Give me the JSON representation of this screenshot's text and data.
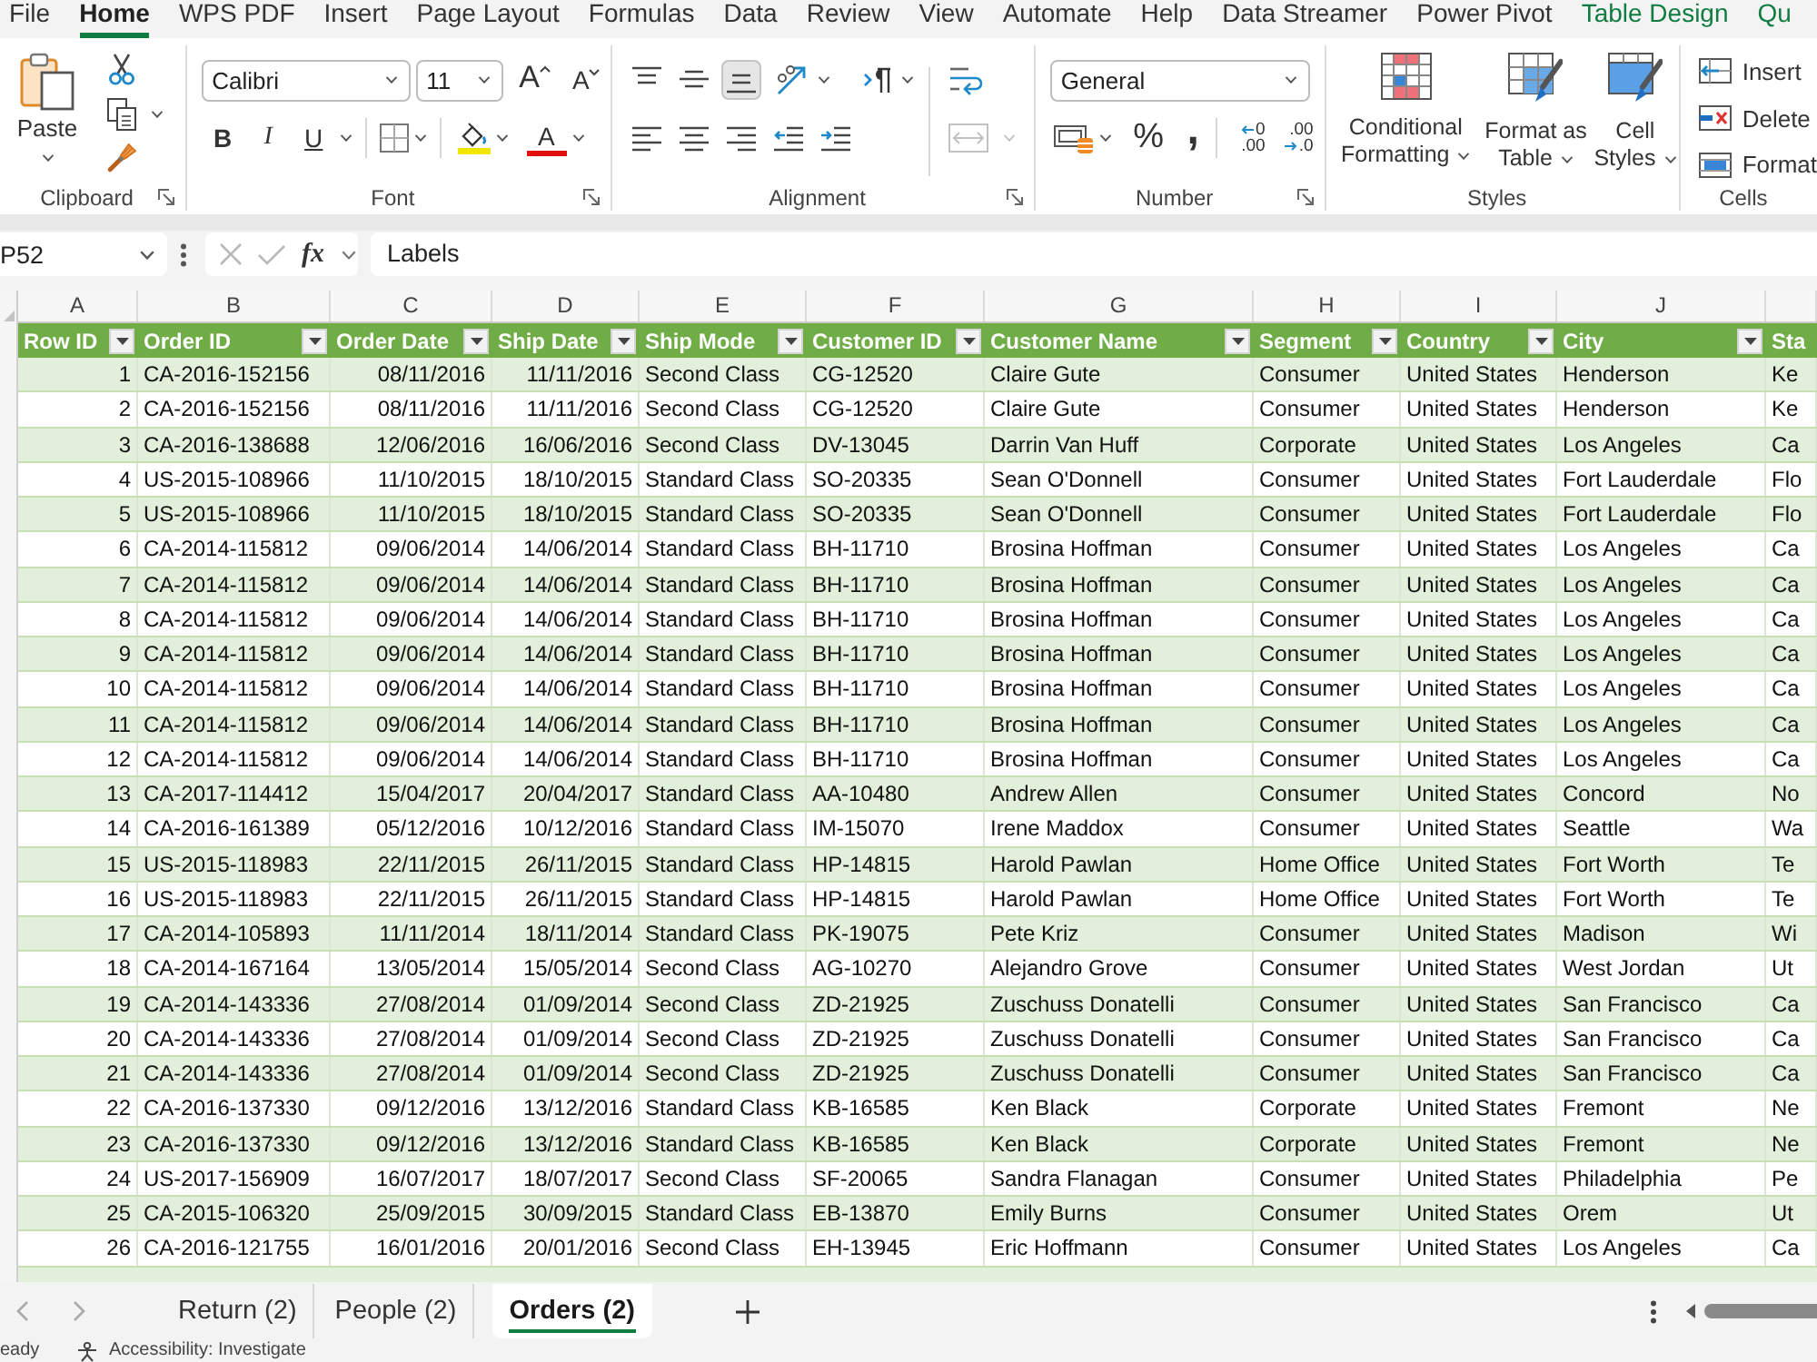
{
  "menu_tabs": [
    {
      "label": "File",
      "selected": false,
      "kind": "standard"
    },
    {
      "label": "Home",
      "selected": true,
      "kind": "standard"
    },
    {
      "label": "WPS PDF",
      "selected": false,
      "kind": "standard"
    },
    {
      "label": "Insert",
      "selected": false,
      "kind": "standard"
    },
    {
      "label": "Page Layout",
      "selected": false,
      "kind": "standard"
    },
    {
      "label": "Formulas",
      "selected": false,
      "kind": "standard"
    },
    {
      "label": "Data",
      "selected": false,
      "kind": "standard"
    },
    {
      "label": "Review",
      "selected": false,
      "kind": "standard"
    },
    {
      "label": "View",
      "selected": false,
      "kind": "standard"
    },
    {
      "label": "Automate",
      "selected": false,
      "kind": "standard"
    },
    {
      "label": "Help",
      "selected": false,
      "kind": "standard"
    },
    {
      "label": "Data Streamer",
      "selected": false,
      "kind": "standard"
    },
    {
      "label": "Power Pivot",
      "selected": false,
      "kind": "standard"
    },
    {
      "label": "Table Design",
      "selected": false,
      "kind": "contextual"
    },
    {
      "label": "Qu",
      "selected": false,
      "kind": "contextual"
    }
  ],
  "ribbon": {
    "clipboard": {
      "label": "Clipboard",
      "paste": "Paste"
    },
    "font": {
      "label": "Font",
      "font_name": "Calibri",
      "font_size": "11",
      "grow": "A",
      "shrink": "A",
      "bold": "B",
      "italic": "I",
      "underline": "U",
      "font_color": "A"
    },
    "alignment": {
      "label": "Alignment",
      "vertical": [
        {
          "kind": "top",
          "selected": false
        },
        {
          "kind": "middle",
          "selected": false
        },
        {
          "kind": "bottom",
          "selected": true
        }
      ],
      "merge_disabled": true
    },
    "number": {
      "label": "Number",
      "format": "General",
      "percent": "%",
      "comma": ",",
      "decimals": [
        {
          "kind": "increase",
          "upper": "0",
          "lower": ".00"
        },
        {
          "kind": "decrease",
          "upper": ".00",
          "lower": ".0"
        }
      ]
    },
    "styles": {
      "label": "Styles",
      "buttons": [
        {
          "kind": "conditional",
          "label": "Conditional Formatting"
        },
        {
          "kind": "table",
          "label": "Format as Table"
        },
        {
          "kind": "cell",
          "label": "Cell Styles"
        }
      ]
    },
    "cells": {
      "label": "Cells",
      "buttons": [
        {
          "kind": "insert",
          "label": "Insert"
        },
        {
          "kind": "delete",
          "label": "Delete"
        },
        {
          "kind": "format",
          "label": "Format"
        }
      ]
    }
  },
  "formula_bar": {
    "name_box": "P52",
    "function_label": "fx",
    "formula": "Labels",
    "edit_disabled": true
  },
  "table": {
    "columns": [
      {
        "letter": "A",
        "header": "Row ID",
        "kind": "number",
        "filter": true
      },
      {
        "letter": "B",
        "header": "Order ID",
        "kind": "text",
        "filter": true
      },
      {
        "letter": "C",
        "header": "Order Date",
        "kind": "date",
        "filter": true
      },
      {
        "letter": "D",
        "header": "Ship Date",
        "kind": "date",
        "filter": true
      },
      {
        "letter": "E",
        "header": "Ship Mode",
        "kind": "text",
        "filter": true
      },
      {
        "letter": "F",
        "header": "Customer ID",
        "kind": "text",
        "filter": true
      },
      {
        "letter": "G",
        "header": "Customer Name",
        "kind": "text",
        "filter": true
      },
      {
        "letter": "H",
        "header": "Segment",
        "kind": "text",
        "filter": true
      },
      {
        "letter": "I",
        "header": "Country",
        "kind": "text",
        "filter": true
      },
      {
        "letter": "J",
        "header": "City",
        "kind": "text",
        "filter": true
      },
      {
        "header": "Sta",
        "kind": "text",
        "filter": false
      }
    ],
    "rows": [
      [
        "1",
        "CA-2016-152156",
        "08/11/2016",
        "11/11/2016",
        "Second Class",
        "CG-12520",
        "Claire Gute",
        "Consumer",
        "United States",
        "Henderson",
        "Ke"
      ],
      [
        "2",
        "CA-2016-152156",
        "08/11/2016",
        "11/11/2016",
        "Second Class",
        "CG-12520",
        "Claire Gute",
        "Consumer",
        "United States",
        "Henderson",
        "Ke"
      ],
      [
        "3",
        "CA-2016-138688",
        "12/06/2016",
        "16/06/2016",
        "Second Class",
        "DV-13045",
        "Darrin Van Huff",
        "Corporate",
        "United States",
        "Los Angeles",
        "Ca"
      ],
      [
        "4",
        "US-2015-108966",
        "11/10/2015",
        "18/10/2015",
        "Standard Class",
        "SO-20335",
        "Sean O'Donnell",
        "Consumer",
        "United States",
        "Fort Lauderdale",
        "Flo"
      ],
      [
        "5",
        "US-2015-108966",
        "11/10/2015",
        "18/10/2015",
        "Standard Class",
        "SO-20335",
        "Sean O'Donnell",
        "Consumer",
        "United States",
        "Fort Lauderdale",
        "Flo"
      ],
      [
        "6",
        "CA-2014-115812",
        "09/06/2014",
        "14/06/2014",
        "Standard Class",
        "BH-11710",
        "Brosina Hoffman",
        "Consumer",
        "United States",
        "Los Angeles",
        "Ca"
      ],
      [
        "7",
        "CA-2014-115812",
        "09/06/2014",
        "14/06/2014",
        "Standard Class",
        "BH-11710",
        "Brosina Hoffman",
        "Consumer",
        "United States",
        "Los Angeles",
        "Ca"
      ],
      [
        "8",
        "CA-2014-115812",
        "09/06/2014",
        "14/06/2014",
        "Standard Class",
        "BH-11710",
        "Brosina Hoffman",
        "Consumer",
        "United States",
        "Los Angeles",
        "Ca"
      ],
      [
        "9",
        "CA-2014-115812",
        "09/06/2014",
        "14/06/2014",
        "Standard Class",
        "BH-11710",
        "Brosina Hoffman",
        "Consumer",
        "United States",
        "Los Angeles",
        "Ca"
      ],
      [
        "10",
        "CA-2014-115812",
        "09/06/2014",
        "14/06/2014",
        "Standard Class",
        "BH-11710",
        "Brosina Hoffman",
        "Consumer",
        "United States",
        "Los Angeles",
        "Ca"
      ],
      [
        "11",
        "CA-2014-115812",
        "09/06/2014",
        "14/06/2014",
        "Standard Class",
        "BH-11710",
        "Brosina Hoffman",
        "Consumer",
        "United States",
        "Los Angeles",
        "Ca"
      ],
      [
        "12",
        "CA-2014-115812",
        "09/06/2014",
        "14/06/2014",
        "Standard Class",
        "BH-11710",
        "Brosina Hoffman",
        "Consumer",
        "United States",
        "Los Angeles",
        "Ca"
      ],
      [
        "13",
        "CA-2017-114412",
        "15/04/2017",
        "20/04/2017",
        "Standard Class",
        "AA-10480",
        "Andrew Allen",
        "Consumer",
        "United States",
        "Concord",
        "No"
      ],
      [
        "14",
        "CA-2016-161389",
        "05/12/2016",
        "10/12/2016",
        "Standard Class",
        "IM-15070",
        "Irene Maddox",
        "Consumer",
        "United States",
        "Seattle",
        "Wa"
      ],
      [
        "15",
        "US-2015-118983",
        "22/11/2015",
        "26/11/2015",
        "Standard Class",
        "HP-14815",
        "Harold Pawlan",
        "Home Office",
        "United States",
        "Fort Worth",
        "Te"
      ],
      [
        "16",
        "US-2015-118983",
        "22/11/2015",
        "26/11/2015",
        "Standard Class",
        "HP-14815",
        "Harold Pawlan",
        "Home Office",
        "United States",
        "Fort Worth",
        "Te"
      ],
      [
        "17",
        "CA-2014-105893",
        "11/11/2014",
        "18/11/2014",
        "Standard Class",
        "PK-19075",
        "Pete Kriz",
        "Consumer",
        "United States",
        "Madison",
        "Wi"
      ],
      [
        "18",
        "CA-2014-167164",
        "13/05/2014",
        "15/05/2014",
        "Second Class",
        "AG-10270",
        "Alejandro Grove",
        "Consumer",
        "United States",
        "West Jordan",
        "Ut"
      ],
      [
        "19",
        "CA-2014-143336",
        "27/08/2014",
        "01/09/2014",
        "Second Class",
        "ZD-21925",
        "Zuschuss Donatelli",
        "Consumer",
        "United States",
        "San Francisco",
        "Ca"
      ],
      [
        "20",
        "CA-2014-143336",
        "27/08/2014",
        "01/09/2014",
        "Second Class",
        "ZD-21925",
        "Zuschuss Donatelli",
        "Consumer",
        "United States",
        "San Francisco",
        "Ca"
      ],
      [
        "21",
        "CA-2014-143336",
        "27/08/2014",
        "01/09/2014",
        "Second Class",
        "ZD-21925",
        "Zuschuss Donatelli",
        "Consumer",
        "United States",
        "San Francisco",
        "Ca"
      ],
      [
        "22",
        "CA-2016-137330",
        "09/12/2016",
        "13/12/2016",
        "Standard Class",
        "KB-16585",
        "Ken Black",
        "Corporate",
        "United States",
        "Fremont",
        "Ne"
      ],
      [
        "23",
        "CA-2016-137330",
        "09/12/2016",
        "13/12/2016",
        "Standard Class",
        "KB-16585",
        "Ken Black",
        "Corporate",
        "United States",
        "Fremont",
        "Ne"
      ],
      [
        "24",
        "US-2017-156909",
        "16/07/2017",
        "18/07/2017",
        "Second Class",
        "SF-20065",
        "Sandra Flanagan",
        "Consumer",
        "United States",
        "Philadelphia",
        "Pe"
      ],
      [
        "25",
        "CA-2015-106320",
        "25/09/2015",
        "30/09/2015",
        "Standard Class",
        "EB-13870",
        "Emily Burns",
        "Consumer",
        "United States",
        "Orem",
        "Ut"
      ],
      [
        "26",
        "CA-2016-121755",
        "16/01/2016",
        "20/01/2016",
        "Second Class",
        "EH-13945",
        "Eric Hoffmann",
        "Consumer",
        "United States",
        "Los Angeles",
        "Ca"
      ]
    ]
  },
  "sheet_tabs": [
    {
      "label": "Return (2)",
      "selected": false
    },
    {
      "label": "People (2)",
      "selected": false
    },
    {
      "label": "Orders (2)",
      "selected": true
    }
  ],
  "status_bar": {
    "mode": "eady",
    "accessibility": "Accessibility: Investigate"
  }
}
